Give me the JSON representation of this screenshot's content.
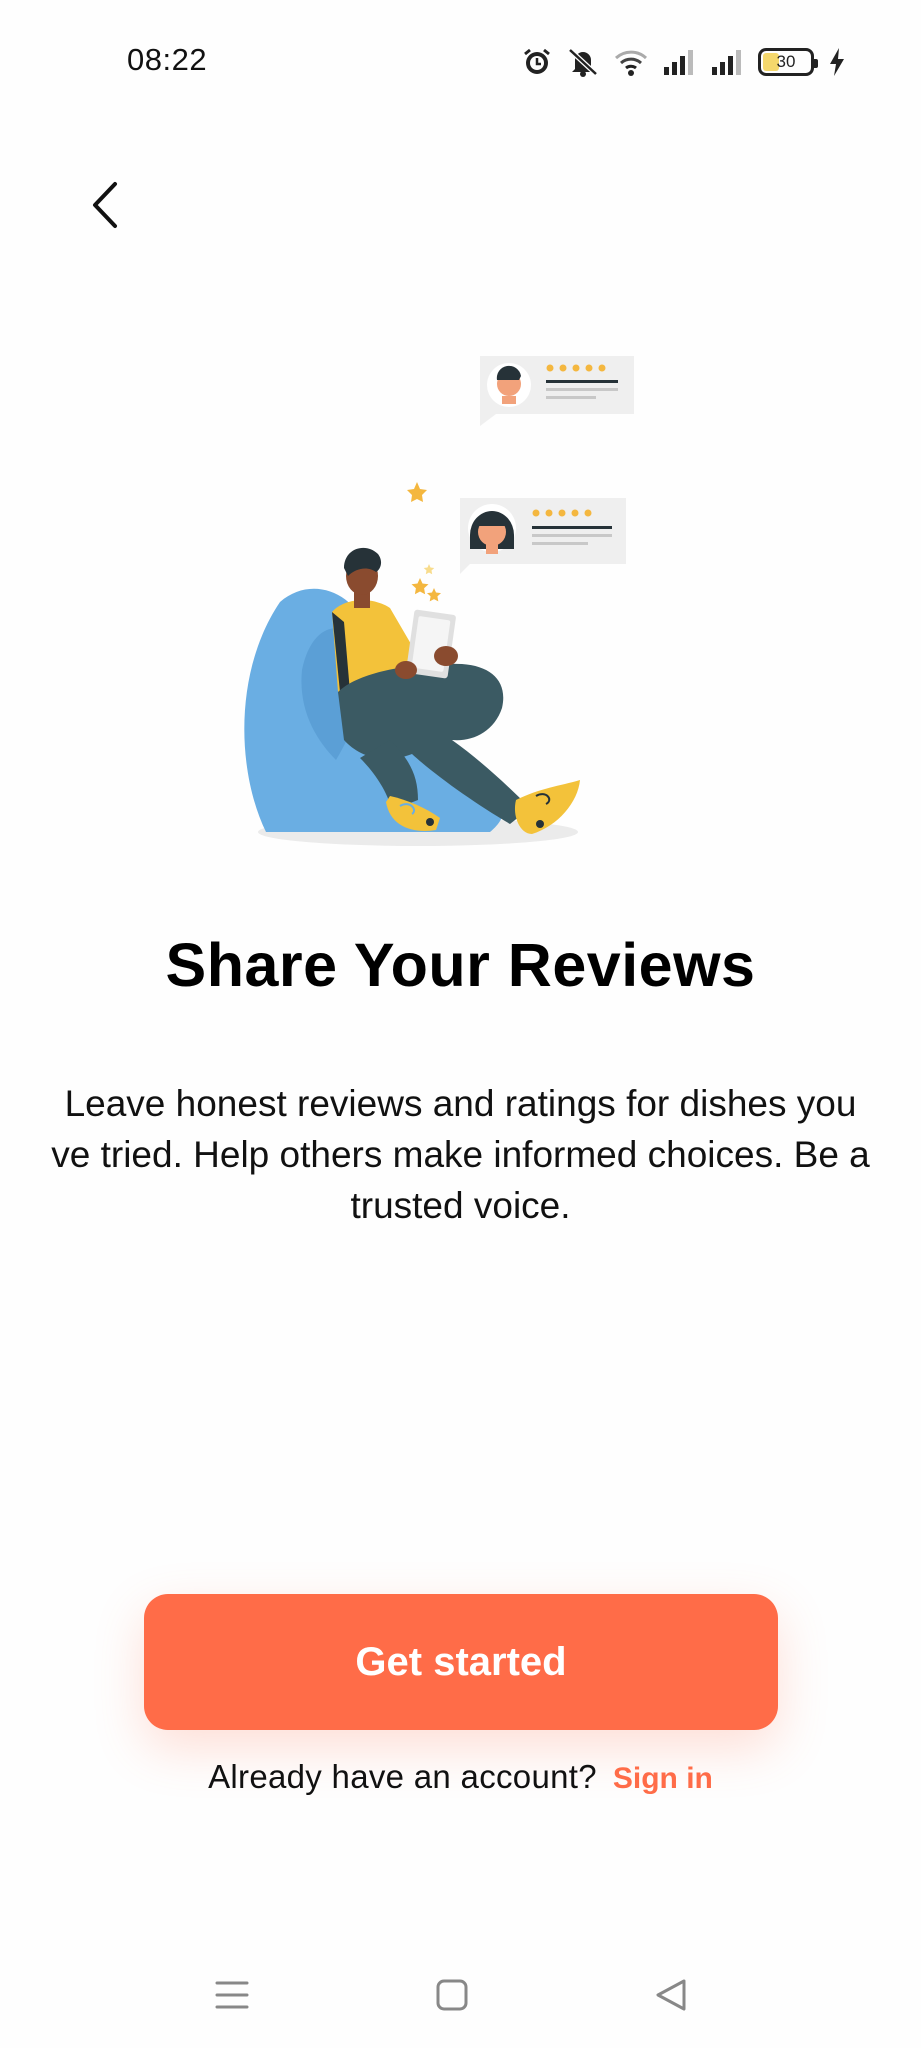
{
  "status_bar": {
    "time": "08:22",
    "battery_level": "30",
    "icons": [
      "alarm-icon",
      "mute-icon",
      "wifi-icon",
      "signal-icon",
      "signal-icon",
      "battery-icon",
      "charging-icon"
    ]
  },
  "navigation": {
    "back_icon": "chevron-left-icon"
  },
  "onboarding": {
    "title": "Share Your Reviews",
    "description": "Leave honest reviews and ratings for dishes you ve tried. Help others make informed choices. Be a trusted voice.",
    "cta_label": "Get started",
    "signin_prompt": "Already have an account?",
    "signin_label": "Sign in"
  },
  "system_nav": {
    "icons": [
      "menu-icon",
      "home-icon",
      "back-triangle-icon"
    ]
  },
  "colors": {
    "accent": "#ff6c48",
    "background": "#fefefe",
    "star": "#f4b73f",
    "chair": "#6aaee3",
    "shirt": "#f3c23a",
    "pants": "#3b5a63"
  }
}
